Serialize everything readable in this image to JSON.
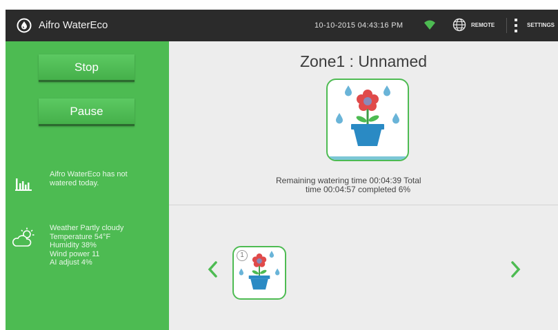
{
  "header": {
    "app_title": "Aifro WaterEco",
    "datetime": "10-10-2015 04:43:16 PM",
    "remote_label": "REMOTE",
    "settings_label": "SETTINGS",
    "logo_icon": "water-drop-logo-icon",
    "wifi_icon": "wifi-icon",
    "globe_icon": "globe-icon"
  },
  "controls": {
    "stop_label": "Stop",
    "pause_label": "Pause"
  },
  "stats": {
    "icon": "bar-chart-icon",
    "message": "Aifro WaterEco has not watered today."
  },
  "weather": {
    "icon": "partly-cloudy-icon",
    "lines": [
      "Weather Partly cloudy",
      "Temperature 54°F",
      "Humidity 38%",
      "Wind power 11",
      "AI adjust  4%"
    ]
  },
  "zone": {
    "title": "Zone1 : Unnamed",
    "status_line1": "Remaining watering time 00:04:39    Total",
    "status_line2": "time 00:04:57 completed 6%",
    "progress_percent": 6
  },
  "carousel": {
    "items": [
      {
        "badge": "1",
        "icon": "flower-pot-icon"
      }
    ]
  },
  "colors": {
    "accent_green": "#4dbb52",
    "header_dark": "#2b2b2b",
    "pot_blue": "#2a8ac4",
    "flower_red": "#e04a4a",
    "water_drop": "#6ab4d8"
  }
}
